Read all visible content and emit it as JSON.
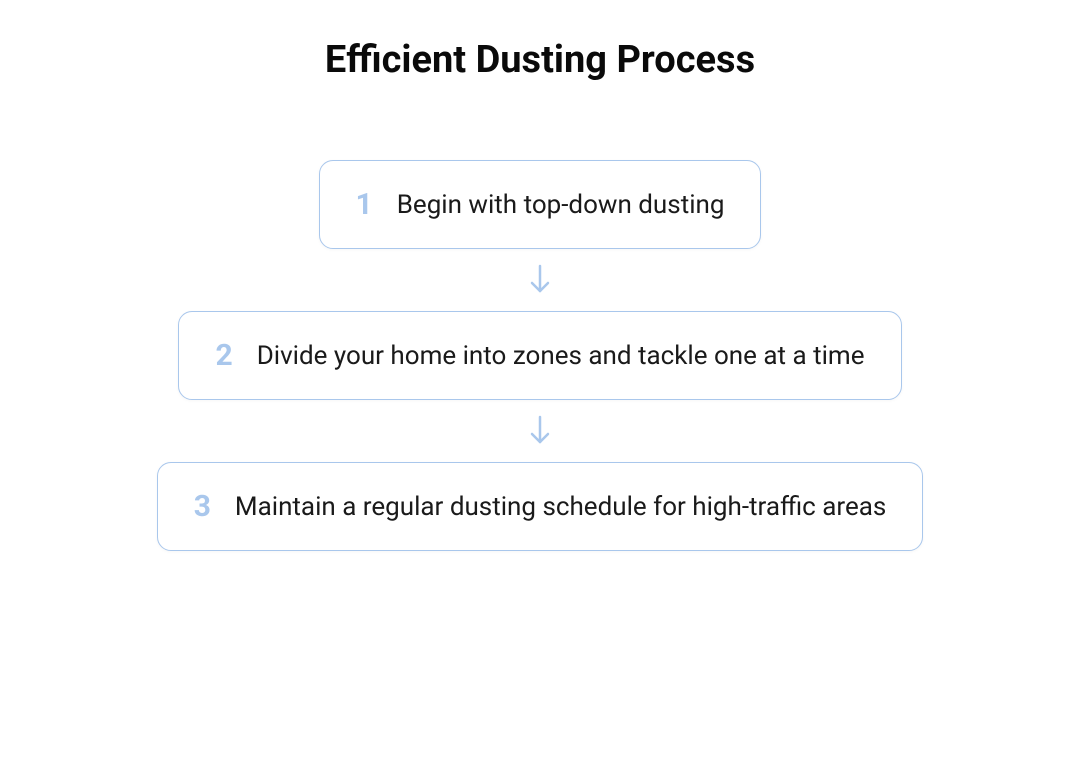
{
  "title": "Efficient Dusting Process",
  "steps": [
    {
      "number": "1",
      "text": "Begin with top-down dusting"
    },
    {
      "number": "2",
      "text": "Divide your home into zones and tackle one at a time"
    },
    {
      "number": "3",
      "text": "Maintain a regular dusting schedule for high-traffic areas"
    }
  ]
}
